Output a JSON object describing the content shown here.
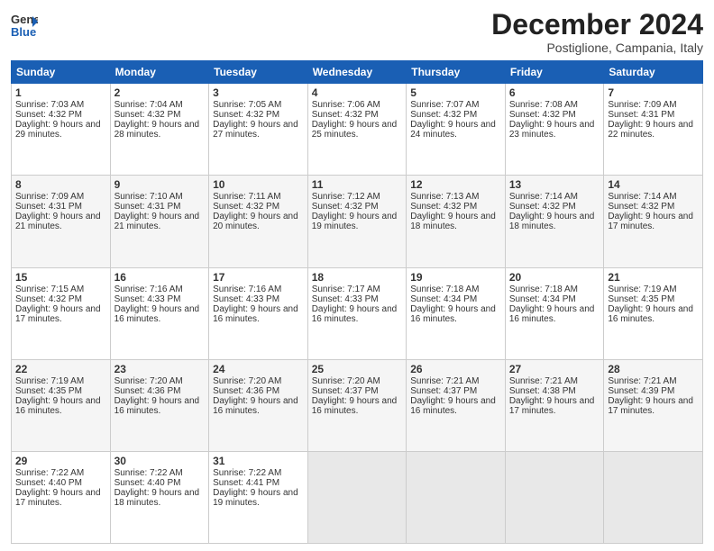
{
  "header": {
    "logo_line1": "General",
    "logo_line2": "Blue",
    "month": "December 2024",
    "location": "Postiglione, Campania, Italy"
  },
  "weekdays": [
    "Sunday",
    "Monday",
    "Tuesday",
    "Wednesday",
    "Thursday",
    "Friday",
    "Saturday"
  ],
  "weeks": [
    [
      {
        "day": "1",
        "sr": "7:03 AM",
        "ss": "4:32 PM",
        "dl": "9 hours and 29 minutes."
      },
      {
        "day": "2",
        "sr": "7:04 AM",
        "ss": "4:32 PM",
        "dl": "9 hours and 28 minutes."
      },
      {
        "day": "3",
        "sr": "7:05 AM",
        "ss": "4:32 PM",
        "dl": "9 hours and 27 minutes."
      },
      {
        "day": "4",
        "sr": "7:06 AM",
        "ss": "4:32 PM",
        "dl": "9 hours and 25 minutes."
      },
      {
        "day": "5",
        "sr": "7:07 AM",
        "ss": "4:32 PM",
        "dl": "9 hours and 24 minutes."
      },
      {
        "day": "6",
        "sr": "7:08 AM",
        "ss": "4:32 PM",
        "dl": "9 hours and 23 minutes."
      },
      {
        "day": "7",
        "sr": "7:09 AM",
        "ss": "4:31 PM",
        "dl": "9 hours and 22 minutes."
      }
    ],
    [
      {
        "day": "8",
        "sr": "7:09 AM",
        "ss": "4:31 PM",
        "dl": "9 hours and 21 minutes."
      },
      {
        "day": "9",
        "sr": "7:10 AM",
        "ss": "4:31 PM",
        "dl": "9 hours and 21 minutes."
      },
      {
        "day": "10",
        "sr": "7:11 AM",
        "ss": "4:32 PM",
        "dl": "9 hours and 20 minutes."
      },
      {
        "day": "11",
        "sr": "7:12 AM",
        "ss": "4:32 PM",
        "dl": "9 hours and 19 minutes."
      },
      {
        "day": "12",
        "sr": "7:13 AM",
        "ss": "4:32 PM",
        "dl": "9 hours and 18 minutes."
      },
      {
        "day": "13",
        "sr": "7:14 AM",
        "ss": "4:32 PM",
        "dl": "9 hours and 18 minutes."
      },
      {
        "day": "14",
        "sr": "7:14 AM",
        "ss": "4:32 PM",
        "dl": "9 hours and 17 minutes."
      }
    ],
    [
      {
        "day": "15",
        "sr": "7:15 AM",
        "ss": "4:32 PM",
        "dl": "9 hours and 17 minutes."
      },
      {
        "day": "16",
        "sr": "7:16 AM",
        "ss": "4:33 PM",
        "dl": "9 hours and 16 minutes."
      },
      {
        "day": "17",
        "sr": "7:16 AM",
        "ss": "4:33 PM",
        "dl": "9 hours and 16 minutes."
      },
      {
        "day": "18",
        "sr": "7:17 AM",
        "ss": "4:33 PM",
        "dl": "9 hours and 16 minutes."
      },
      {
        "day": "19",
        "sr": "7:18 AM",
        "ss": "4:34 PM",
        "dl": "9 hours and 16 minutes."
      },
      {
        "day": "20",
        "sr": "7:18 AM",
        "ss": "4:34 PM",
        "dl": "9 hours and 16 minutes."
      },
      {
        "day": "21",
        "sr": "7:19 AM",
        "ss": "4:35 PM",
        "dl": "9 hours and 16 minutes."
      }
    ],
    [
      {
        "day": "22",
        "sr": "7:19 AM",
        "ss": "4:35 PM",
        "dl": "9 hours and 16 minutes."
      },
      {
        "day": "23",
        "sr": "7:20 AM",
        "ss": "4:36 PM",
        "dl": "9 hours and 16 minutes."
      },
      {
        "day": "24",
        "sr": "7:20 AM",
        "ss": "4:36 PM",
        "dl": "9 hours and 16 minutes."
      },
      {
        "day": "25",
        "sr": "7:20 AM",
        "ss": "4:37 PM",
        "dl": "9 hours and 16 minutes."
      },
      {
        "day": "26",
        "sr": "7:21 AM",
        "ss": "4:37 PM",
        "dl": "9 hours and 16 minutes."
      },
      {
        "day": "27",
        "sr": "7:21 AM",
        "ss": "4:38 PM",
        "dl": "9 hours and 17 minutes."
      },
      {
        "day": "28",
        "sr": "7:21 AM",
        "ss": "4:39 PM",
        "dl": "9 hours and 17 minutes."
      }
    ],
    [
      {
        "day": "29",
        "sr": "7:22 AM",
        "ss": "4:40 PM",
        "dl": "9 hours and 17 minutes."
      },
      {
        "day": "30",
        "sr": "7:22 AM",
        "ss": "4:40 PM",
        "dl": "9 hours and 18 minutes."
      },
      {
        "day": "31",
        "sr": "7:22 AM",
        "ss": "4:41 PM",
        "dl": "9 hours and 19 minutes."
      },
      null,
      null,
      null,
      null
    ]
  ],
  "labels": {
    "sunrise": "Sunrise:",
    "sunset": "Sunset:",
    "daylight": "Daylight:"
  }
}
